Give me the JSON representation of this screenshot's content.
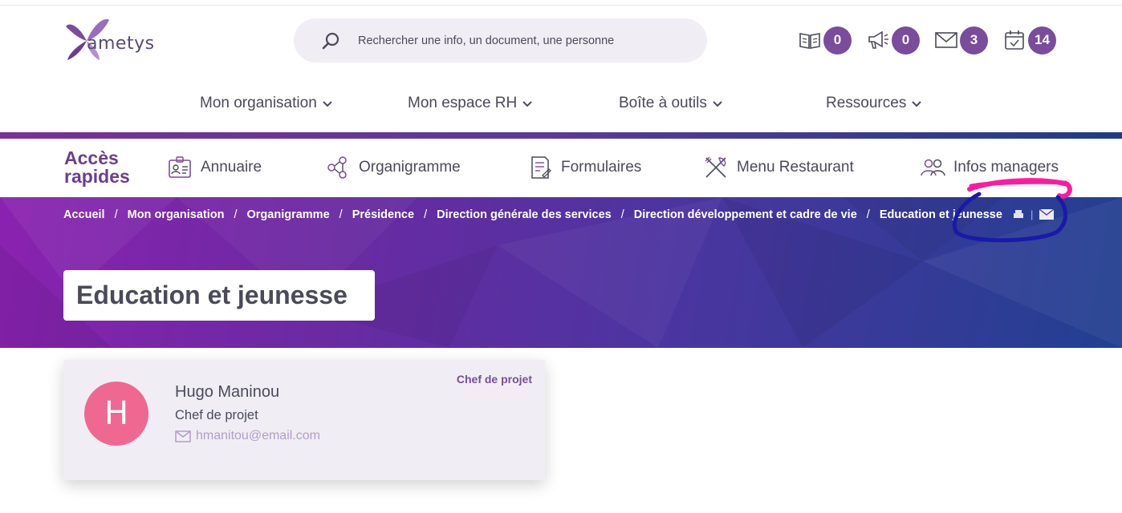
{
  "brand": {
    "logo_text": "ametys"
  },
  "search": {
    "placeholder": "Rechercher une info, un document, une personne"
  },
  "notifications": [
    {
      "icon": "news-icon",
      "count": "0"
    },
    {
      "icon": "megaphone-icon",
      "count": "0"
    },
    {
      "icon": "mail-icon",
      "count": "3"
    },
    {
      "icon": "calendar-icon",
      "count": "14"
    }
  ],
  "main_nav": [
    {
      "label": "Mon organisation"
    },
    {
      "label": "Mon espace RH"
    },
    {
      "label": "Boîte à outils"
    },
    {
      "label": "Ressources"
    }
  ],
  "quick_access": {
    "title_line1": "Accès",
    "title_line2": "rapides",
    "items": [
      {
        "label": "Annuaire",
        "icon": "id-card-icon"
      },
      {
        "label": "Organigramme",
        "icon": "org-chart-icon"
      },
      {
        "label": "Formulaires",
        "icon": "form-icon"
      },
      {
        "label": "Menu Restaurant",
        "icon": "cutlery-icon"
      },
      {
        "label": "Infos managers",
        "icon": "managers-icon"
      }
    ]
  },
  "breadcrumb": [
    "Accueil",
    "Mon organisation",
    "Organigramme",
    "Présidence",
    "Direction générale des services",
    "Direction développement et cadre de vie",
    "Education et jeunesse"
  ],
  "page": {
    "title": "Education et jeunesse"
  },
  "colors": {
    "accent": "#7a4c9c",
    "avatar": "#ef6892",
    "card_bg": "#f0eef4"
  },
  "card": {
    "avatar_letter": "H",
    "role_tag": "Chef de projet",
    "name": "Hugo Maninou",
    "title": "Chef de projet",
    "email": "hmanitou@email.com"
  }
}
